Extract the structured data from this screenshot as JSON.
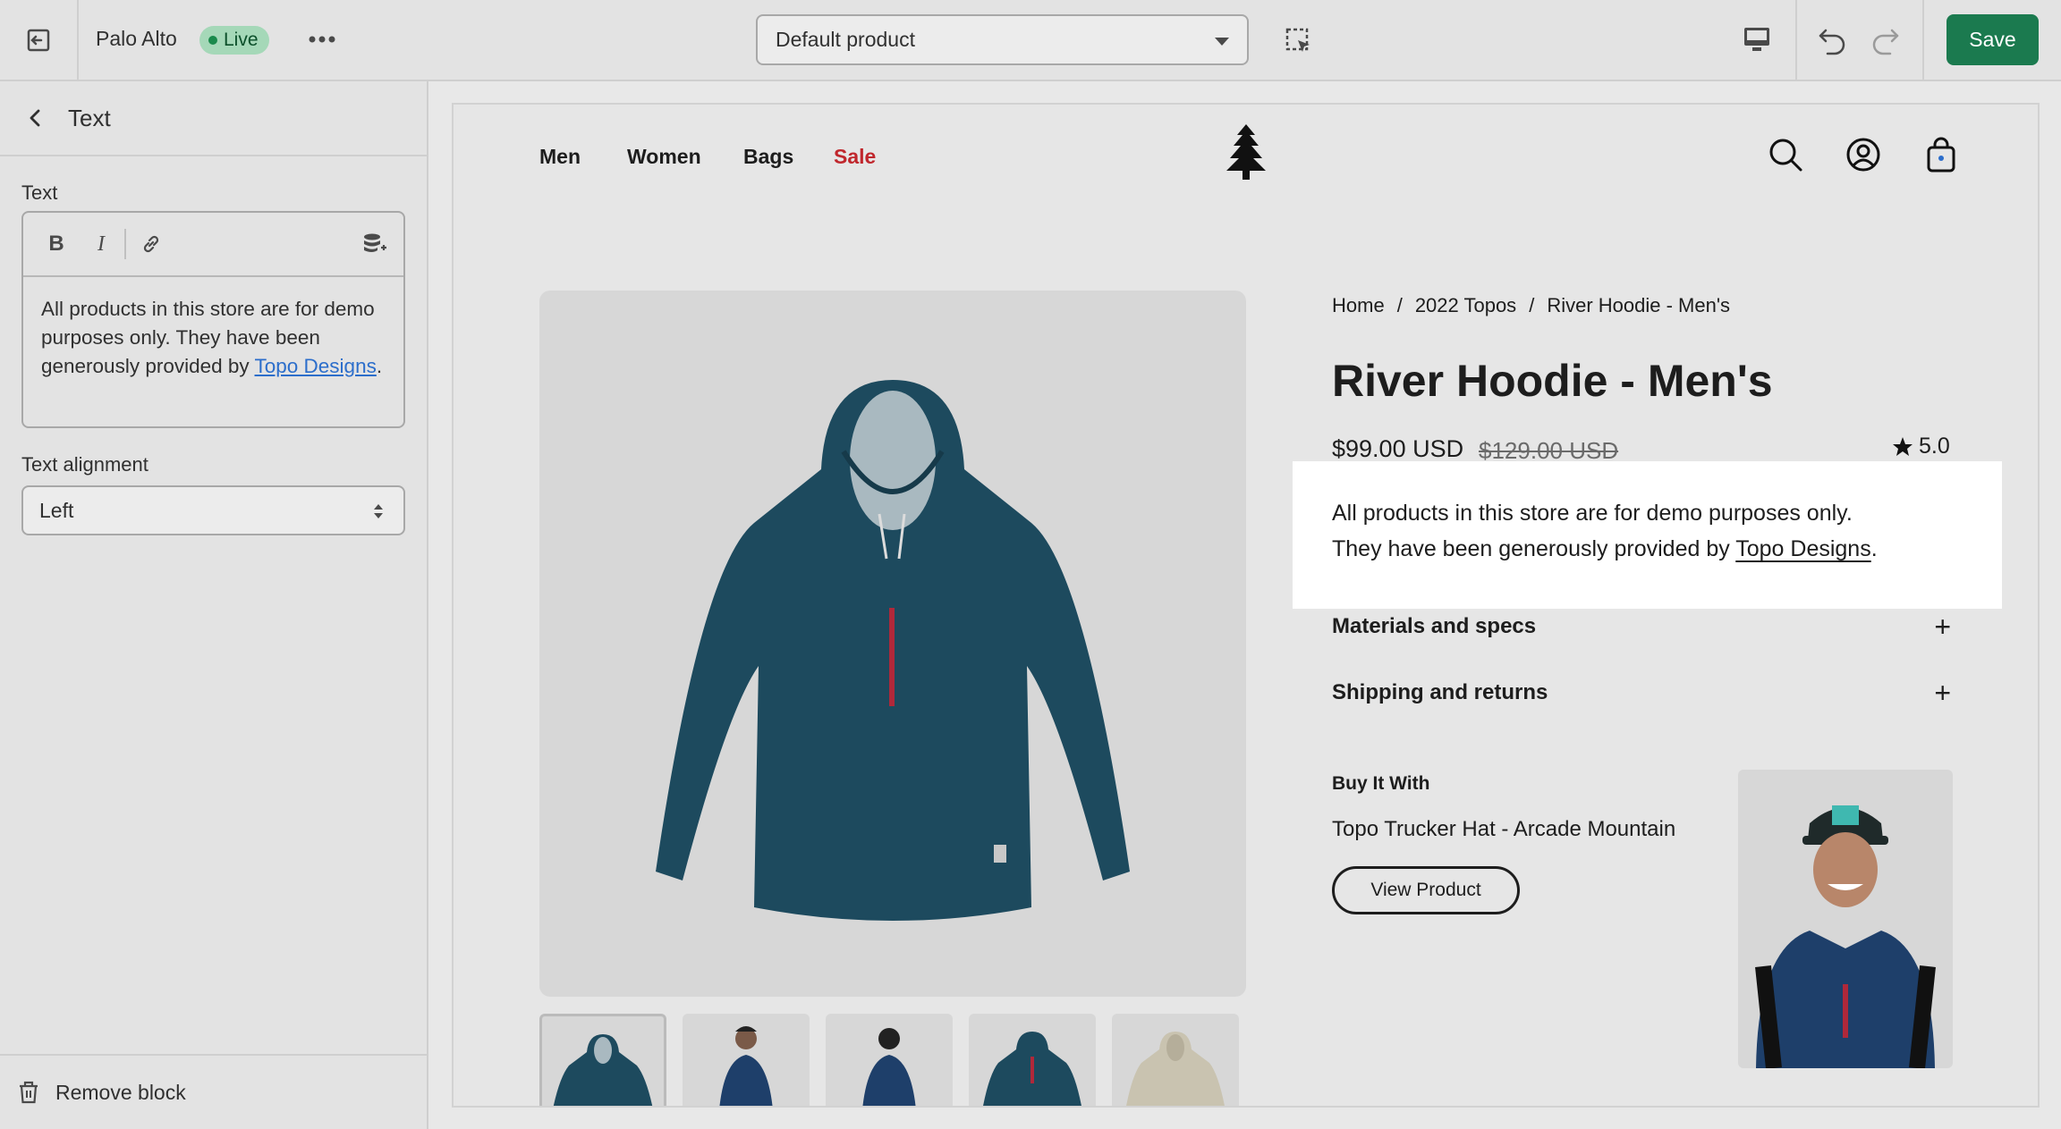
{
  "topbar": {
    "store_name": "Palo Alto",
    "status_badge": "Live",
    "template_select": "Default product",
    "save_label": "Save"
  },
  "sidebar": {
    "title": "Text",
    "text_label": "Text",
    "text_content_before_link": "All products in this store are for demo purposes only. They have been generously provided by ",
    "text_content_link": "Topo Designs",
    "text_content_after_link": ".",
    "alignment_label": "Text alignment",
    "alignment_value": "Left",
    "remove_block_label": "Remove block"
  },
  "store": {
    "nav": [
      "Men",
      "Women",
      "Bags",
      "Sale"
    ],
    "breadcrumb": [
      "Home",
      "/",
      "2022 Topos",
      "/",
      "River Hoodie - Men's"
    ],
    "product_title": "River Hoodie - Men's",
    "price": "$99.00 USD",
    "compare_price": "$129.00 USD",
    "rating": "5.0",
    "text_block": {
      "line1": "All products in this store are for demo purposes only.",
      "line2_before_link": "They have been generously provided by ",
      "link": "Topo Designs",
      "after_link": "."
    },
    "accordions": [
      "Materials and specs",
      "Shipping and returns"
    ],
    "buy_with_heading": "Buy It With",
    "buy_with_product": "Topo Trucker Hat - Arcade Mountain",
    "view_product_label": "View Product"
  },
  "colors": {
    "save_button": "#1b7a4f",
    "live_badge": "#a5d8b8",
    "sale": "#c0272d",
    "hoodie": "#1d4a5e",
    "link": "#2c6ecb"
  },
  "icons": [
    "exit-icon",
    "more-icon",
    "inspector-icon",
    "desktop-icon",
    "undo-icon",
    "redo-icon",
    "back-icon",
    "bold-icon",
    "italic-icon",
    "link-icon",
    "dynamic-source-icon",
    "updown-icon",
    "trash-icon",
    "search-icon",
    "account-icon",
    "cart-icon",
    "star-icon",
    "plus-icon",
    "tree-logo-icon"
  ]
}
